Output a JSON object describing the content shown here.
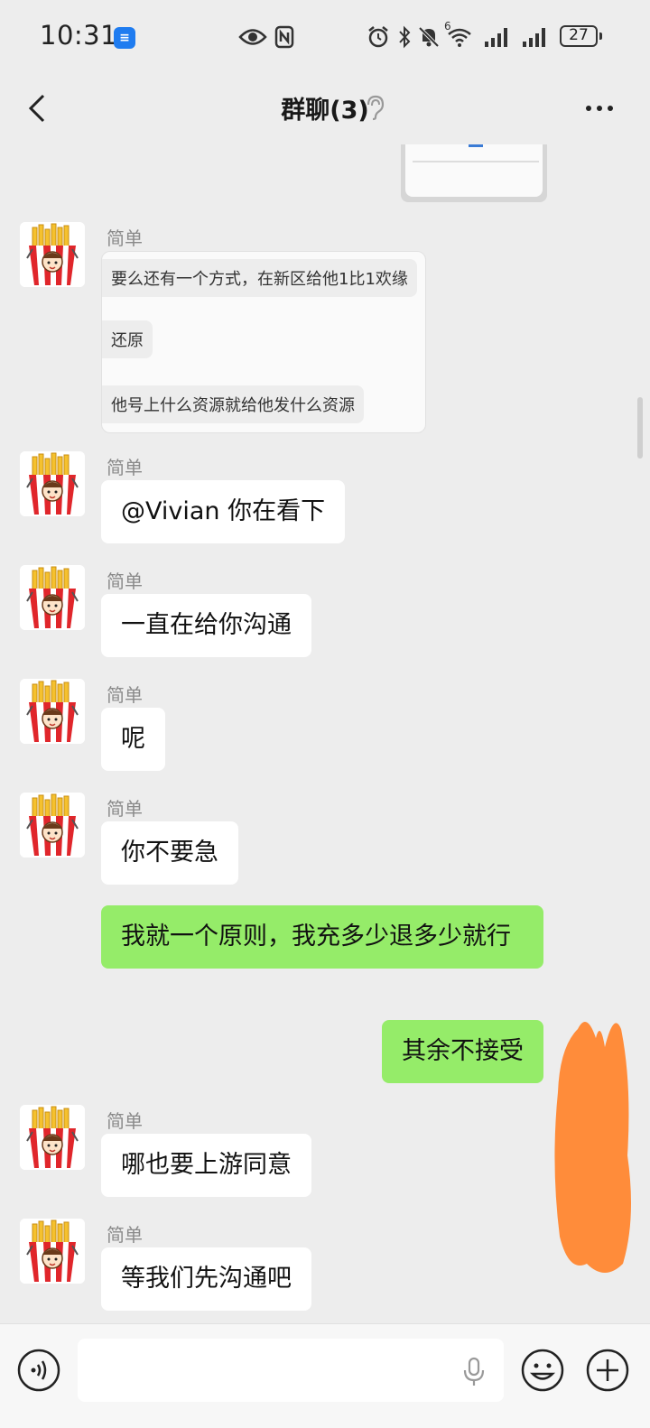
{
  "status_bar": {
    "time": "10:31",
    "battery": "27",
    "network_label": "6"
  },
  "header": {
    "title": "群聊(3)",
    "back_icon": "chevron-left-icon",
    "more_icon": "more-horizontal-icon",
    "earpiece_icon": "earpiece-icon"
  },
  "messages": [
    {
      "type": "quote",
      "sender": "简单",
      "lines": [
        "要么还有一个方式，在新区给他1比1欢缘",
        "还原",
        "他号上什么资源就给他发什么资源"
      ]
    },
    {
      "type": "text",
      "sender": "简单",
      "text": "@Vivian  你在看下"
    },
    {
      "type": "text",
      "sender": "简单",
      "text": "一直在给你沟通"
    },
    {
      "type": "text",
      "sender": "简单",
      "text": "呢"
    },
    {
      "type": "text",
      "sender": "简单",
      "text": "你不要急"
    },
    {
      "type": "text",
      "sender": "me",
      "text": "我就一个原则，我充多少退多少就行"
    },
    {
      "type": "text",
      "sender": "me",
      "text": "其余不接受"
    },
    {
      "type": "text",
      "sender": "简单",
      "text": "哪也要上游同意"
    },
    {
      "type": "text",
      "sender": "简单",
      "text": "等我们先沟通吧"
    }
  ],
  "input_bar": {
    "value": "",
    "voice_icon": "voice-icon",
    "mic_icon": "mic-icon",
    "emoji_icon": "emoji-icon",
    "plus_icon": "plus-icon"
  },
  "colors": {
    "background": "#ededed",
    "bubble_other": "#ffffff",
    "bubble_me": "#95ec69",
    "redaction": "#ff8c3a"
  }
}
